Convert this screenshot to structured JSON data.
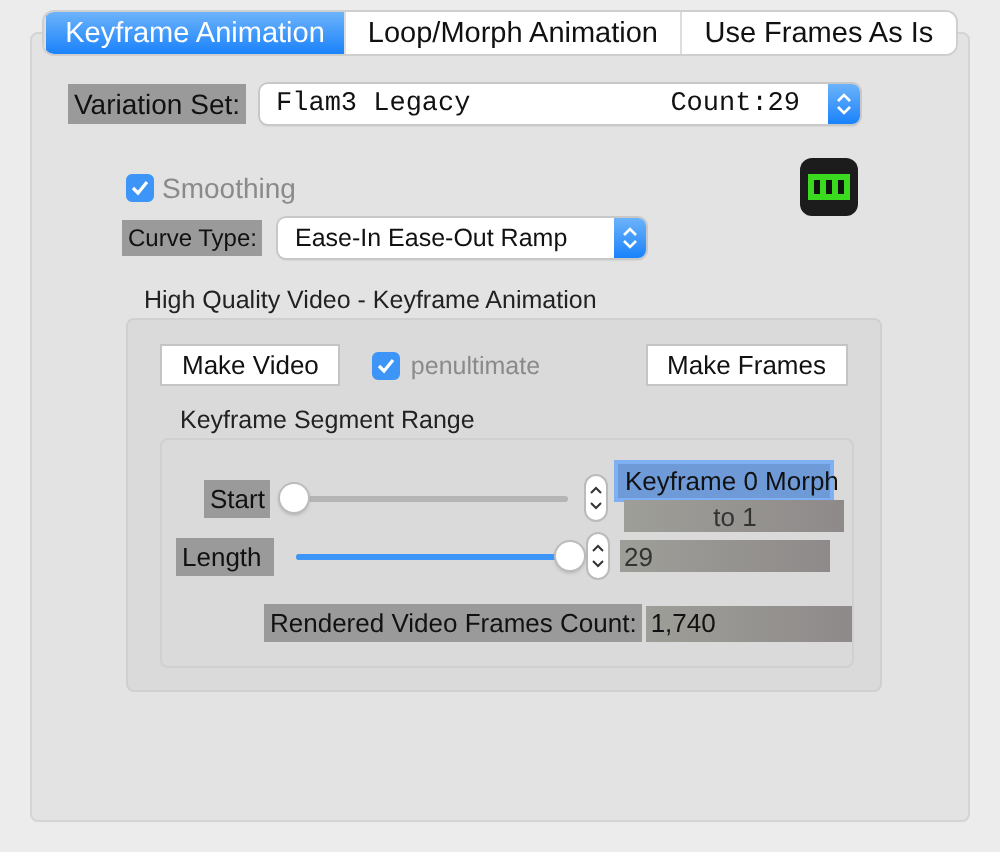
{
  "tabs": [
    {
      "label": "Keyframe Animation",
      "selected": true
    },
    {
      "label": "Loop/Morph Animation",
      "selected": false
    },
    {
      "label": "Use Frames As Is",
      "selected": false
    }
  ],
  "variation_set": {
    "label": "Variation Set:",
    "value": "Flam3 Legacy",
    "count": "Count:29"
  },
  "smoothing": {
    "label": "Smoothing",
    "checked": true
  },
  "curve_type": {
    "label": "Curve Type:",
    "value": "Ease-In Ease-Out Ramp"
  },
  "video_group": {
    "title": "High Quality Video - Keyframe Animation",
    "make_video": "Make Video",
    "penultimate": {
      "label": "penultimate",
      "checked": true
    },
    "make_frames": "Make Frames",
    "segment_range": {
      "title": "Keyframe Segment Range",
      "start": {
        "label": "Start",
        "level": 0,
        "value": "Keyframe 0 Morph",
        "sub_value": "to 1"
      },
      "length": {
        "label": "Length",
        "level": 1,
        "value": "29"
      },
      "rendered": {
        "label": "Rendered Video Frames Count:",
        "value": "1,740"
      }
    }
  }
}
